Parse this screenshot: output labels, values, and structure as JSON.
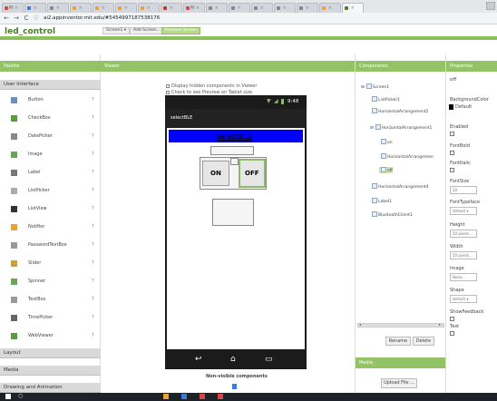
{
  "browser": {
    "tabs": [
      {
        "label": "M",
        "color": "#d44"
      },
      {
        "label": "",
        "color": "#3a7bd5"
      },
      {
        "label": "",
        "color": "#888"
      },
      {
        "label": "",
        "color": "#e9a23b"
      },
      {
        "label": "",
        "color": "#e9a23b"
      },
      {
        "label": "",
        "color": "#e9a23b"
      },
      {
        "label": "",
        "color": "#e9a23b"
      },
      {
        "label": "",
        "color": "#c33"
      },
      {
        "label": "M",
        "color": "#d44"
      },
      {
        "label": "",
        "color": "#888"
      },
      {
        "label": "",
        "color": "#888"
      },
      {
        "label": "",
        "color": "#888"
      },
      {
        "label": "",
        "color": "#888"
      },
      {
        "label": "",
        "color": "#888"
      },
      {
        "label": "",
        "color": "#e9a23b"
      },
      {
        "label": "",
        "color": "#4b7d2b"
      }
    ],
    "url": "ai2.appinventor.mit.edu/#5454997187538176"
  },
  "app": {
    "project_title": "led_control",
    "screen_select": "Screen1 ▾",
    "add_screen": "Add Screen...",
    "remove_screen": "Remove Screen"
  },
  "palette": {
    "header": "Palette",
    "section": "User Interface",
    "help": "?",
    "items": [
      {
        "label": "Button",
        "icon": "button-icon",
        "color": "#6a8fc7"
      },
      {
        "label": "CheckBox",
        "icon": "checkbox-icon",
        "color": "#5b9b3d"
      },
      {
        "label": "DatePicker",
        "icon": "datepicker-icon",
        "color": "#888"
      },
      {
        "label": "Image",
        "icon": "image-icon",
        "color": "#6aa55a"
      },
      {
        "label": "Label",
        "icon": "label-icon",
        "color": "#777"
      },
      {
        "label": "ListPicker",
        "icon": "listpicker-icon",
        "color": "#aaa"
      },
      {
        "label": "ListView",
        "icon": "listview-icon",
        "color": "#333"
      },
      {
        "label": "Notifier",
        "icon": "notifier-icon",
        "color": "#e9a23b"
      },
      {
        "label": "PasswordTextBox",
        "icon": "passwordtextbox-icon",
        "color": "#999"
      },
      {
        "label": "Slider",
        "icon": "slider-icon",
        "color": "#c9a13b"
      },
      {
        "label": "Spinner",
        "icon": "spinner-icon",
        "color": "#6aa55a"
      },
      {
        "label": "TextBox",
        "icon": "textbox-icon",
        "color": "#999"
      },
      {
        "label": "TimePicker",
        "icon": "timepicker-icon",
        "color": "#666"
      },
      {
        "label": "WebViewer",
        "icon": "webviewer-icon",
        "color": "#5b9b3d"
      }
    ],
    "layout": "Layout",
    "media": "Media",
    "drawing": "Drawing and Animation"
  },
  "viewer": {
    "header": "Viewer",
    "display_hidden": "Display hidden components in Viewer",
    "check_tablet": "Check to see Preview on Tablet size.",
    "status_time": "9:48",
    "screen_title": "selectBLE",
    "banner_text": "selectBLE",
    "on_label": "ON",
    "off_label": "OFF",
    "nonvisible": "Non-visible components"
  },
  "components": {
    "header": "Components",
    "tree": [
      {
        "label": "Screen1",
        "depth": 0,
        "toggle": "⊟"
      },
      {
        "label": "ListPicker1",
        "depth": 1,
        "toggle": ""
      },
      {
        "label": "HorizontalArrangement2",
        "depth": 1,
        "toggle": ""
      },
      {
        "label": "HorizontalArrangement1",
        "depth": 1,
        "toggle": "⊟"
      },
      {
        "label": "on",
        "depth": 2,
        "toggle": ""
      },
      {
        "label": "HorizontalArrangemen",
        "depth": 2,
        "toggle": ""
      },
      {
        "label": "off",
        "depth": 2,
        "toggle": ""
      },
      {
        "label": "HorizontalArrangement4",
        "depth": 1,
        "toggle": ""
      },
      {
        "label": "Label1",
        "depth": 1,
        "toggle": ""
      },
      {
        "label": "BluetoothClient1",
        "depth": 1,
        "toggle": ""
      }
    ],
    "rename": "Rename",
    "delete": "Delete",
    "media_header": "Media",
    "upload": "Upload File ..."
  },
  "properties": {
    "header": "Properties",
    "selected": "off",
    "rows": [
      {
        "label": "BackgroundColor",
        "value": "Default"
      },
      {
        "label": "Enabled",
        "value": ""
      },
      {
        "label": "FontBold",
        "value": ""
      },
      {
        "label": "FontItalic",
        "value": ""
      },
      {
        "label": "FontSize",
        "value": "20"
      },
      {
        "label": "FontTypeface",
        "value": "default ▾"
      },
      {
        "label": "Height",
        "value": "50 pixels..."
      },
      {
        "label": "Width",
        "value": "50 pixels..."
      },
      {
        "label": "Image",
        "value": "None..."
      },
      {
        "label": "Shape",
        "value": "default ▾"
      },
      {
        "label": "ShowFeedback",
        "value": ""
      },
      {
        "label": "Text",
        "value": ""
      }
    ]
  },
  "colors": {
    "accent": "#93c267",
    "banner": "#0000ff",
    "selection": "#8fb86a"
  }
}
